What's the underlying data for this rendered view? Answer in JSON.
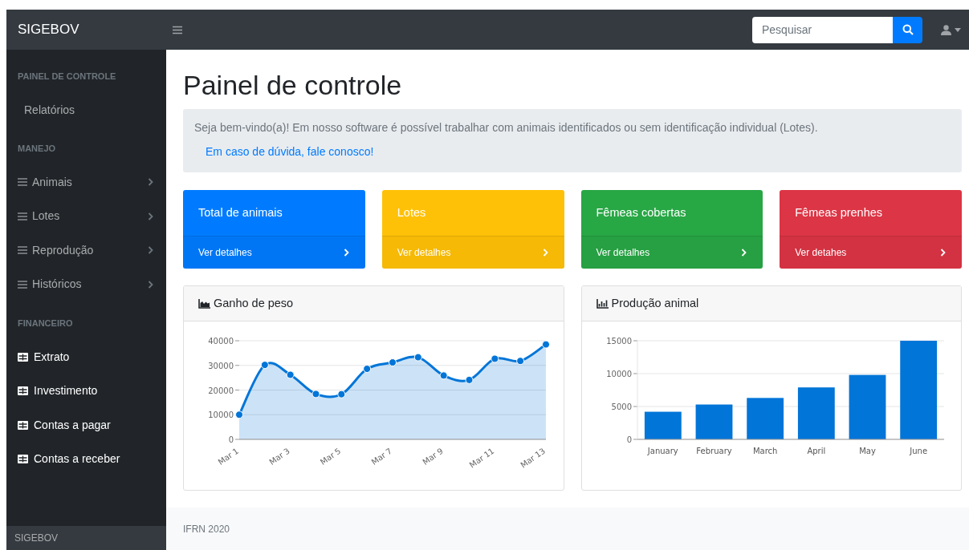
{
  "brand": "SIGEBOV",
  "search": {
    "placeholder": "Pesquisar"
  },
  "sidebar": {
    "sections": [
      {
        "heading": "PAINEL DE CONTROLE",
        "items": [
          {
            "label": "Relatórios",
            "kind": "plain"
          }
        ]
      },
      {
        "heading": "MANEJO",
        "items": [
          {
            "label": "Animais",
            "kind": "menu"
          },
          {
            "label": "Lotes",
            "kind": "menu"
          },
          {
            "label": "Reprodução",
            "kind": "menu"
          },
          {
            "label": "Históricos",
            "kind": "menu"
          }
        ]
      },
      {
        "heading": "FINANCEIRO",
        "items": [
          {
            "label": "Extrato",
            "kind": "table"
          },
          {
            "label": "Investimento",
            "kind": "table"
          },
          {
            "label": "Contas a pagar",
            "kind": "table"
          },
          {
            "label": "Contas a receber",
            "kind": "table"
          }
        ]
      }
    ],
    "footer": "SIGEBOV"
  },
  "page_title": "Painel de controle",
  "alert": {
    "text": "Seja bem-vindo(a)! Em nosso software é possível trabalhar com animais identificados ou sem identificação individual (Lotes).",
    "link": "Em caso de dúvida, fale conosco!"
  },
  "cards": [
    {
      "title": "Total de animais",
      "link": "Ver detalhes",
      "color": "#007bff"
    },
    {
      "title": "Lotes",
      "link": "Ver detalhes",
      "color": "#ffc107"
    },
    {
      "title": "Fêmeas cobertas",
      "link": "Ver detalhes",
      "color": "#28a745"
    },
    {
      "title": "Fêmeas prenhes",
      "link": "Ver detahes",
      "color": "#dc3545"
    }
  ],
  "charts": [
    {
      "kind": "area",
      "chart_data": {
        "type": "area",
        "title": "Ganho de peso",
        "categories": [
          "Mar 1",
          null,
          "Mar 3",
          null,
          "Mar 5",
          null,
          "Mar 7",
          null,
          "Mar 9",
          null,
          "Mar 11",
          null,
          "Mar 13"
        ],
        "series": [
          {
            "color": "#0275d8",
            "values": [
              10000,
              30200,
              26200,
              18400,
              18300,
              28600,
              31200,
              33300,
              25900,
              24100,
              32700,
              31800,
              38500
            ]
          }
        ],
        "ylim": [
          0,
          40000
        ],
        "yticks": [
          0,
          10000,
          20000,
          30000,
          40000
        ],
        "grid": true
      }
    },
    {
      "kind": "bar",
      "chart_data": {
        "type": "bar",
        "title": "Produção animal",
        "categories": [
          "January",
          "February",
          "March",
          "April",
          "May",
          "June"
        ],
        "series": [
          {
            "color": "#0275d8",
            "values": [
              4200,
              5300,
              6300,
              7900,
              9800,
              15000
            ]
          }
        ],
        "ylim": [
          0,
          15000
        ],
        "yticks": [
          0,
          5000,
          10000,
          15000
        ],
        "grid": true
      }
    }
  ],
  "footer": "IFRN 2020"
}
